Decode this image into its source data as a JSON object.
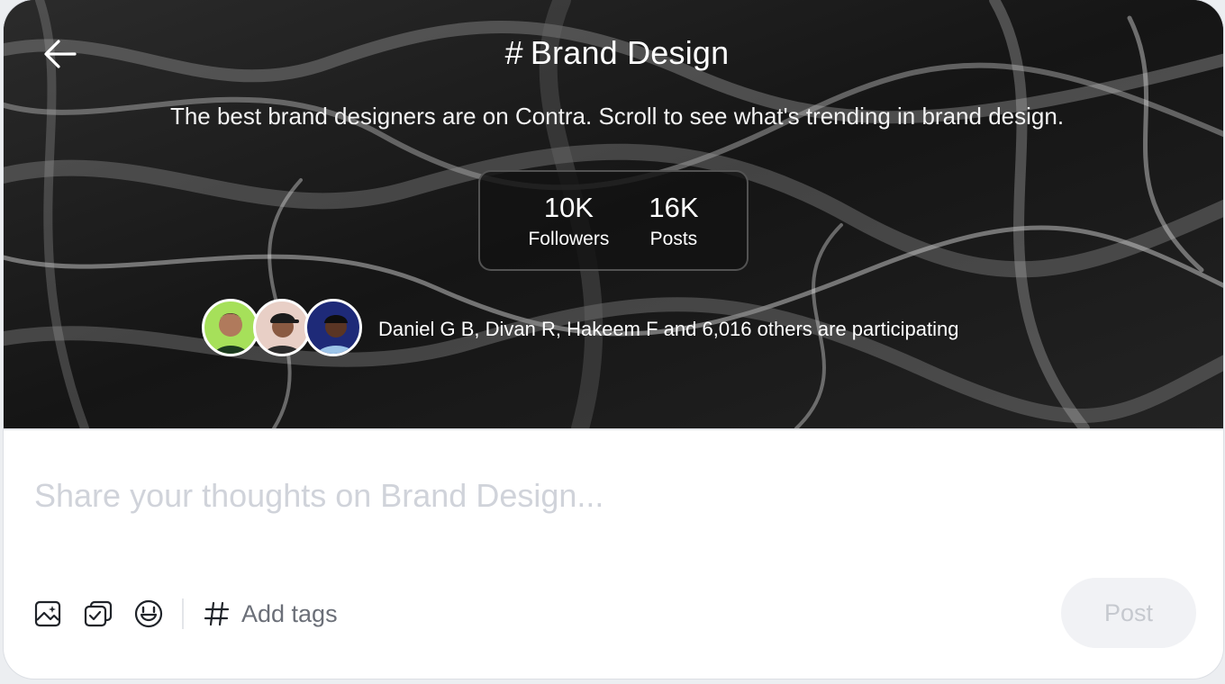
{
  "header": {
    "hash_symbol": "#",
    "title": "Brand Design",
    "description": "The best brand designers are on Contra. Scroll to see what's trending in brand design."
  },
  "stats": [
    {
      "value": "10K",
      "label": "Followers"
    },
    {
      "value": "16K",
      "label": "Posts"
    }
  ],
  "participants": {
    "text": "Daniel G B, Divan R, Hakeem F and 6,016 others are participating",
    "avatars": [
      "avatar-daniel",
      "avatar-divan",
      "avatar-hakeem"
    ]
  },
  "composer": {
    "placeholder": "Share your thoughts on Brand Design...",
    "add_tags_label": "Add tags",
    "post_label": "Post",
    "icons": [
      "image-icon",
      "checklist-icon",
      "emoji-icon",
      "hash-icon",
      "back-arrow-icon"
    ]
  },
  "colors": {
    "hero_bg": "#1a1a1a",
    "post_button_bg": "#f1f2f5",
    "post_button_text": "#c6c9cf",
    "placeholder_text": "#d0d3da"
  }
}
